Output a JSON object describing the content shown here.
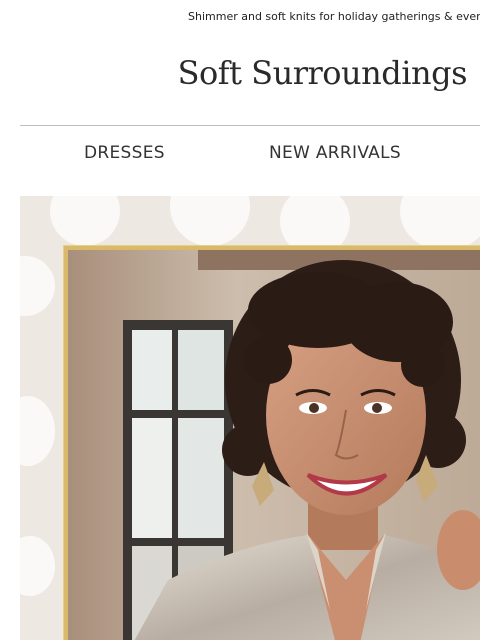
{
  "preheader": {
    "text": "Shimmer and soft knits for holiday gatherings & even"
  },
  "brand": {
    "logo_text": "Soft Surroundings"
  },
  "nav": {
    "items": [
      {
        "label": "DRESSES"
      },
      {
        "label": "NEW ARRIVALS"
      }
    ]
  },
  "hero": {
    "image": "smiling woman with curly hair in a sequined blouse",
    "frame_color": "#d9b96a"
  },
  "colors": {
    "background": "#ffffff",
    "hero_bg": "#ede8e1",
    "gold": "#d9b96a",
    "text": "#222222"
  }
}
